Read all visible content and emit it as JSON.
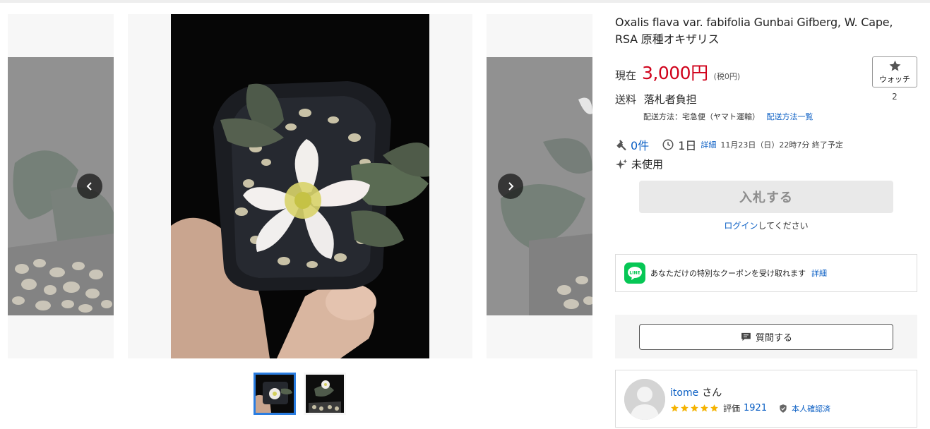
{
  "item": {
    "title": "Oxalis flava var. fabifolia Gunbai Gifberg, W. Cape, RSA 原種オキザリス",
    "price_label": "現在",
    "price_value": "3,000円",
    "price_tax": "(税0円)"
  },
  "watch": {
    "label": "ウォッチ",
    "count": "2",
    "icon": "star-icon"
  },
  "shipping": {
    "label": "送料",
    "value": "落札者負担",
    "method_text": "配送方法：宅急便（ヤマト運輸）",
    "method_link": "配送方法一覧"
  },
  "auction": {
    "bids": "0件",
    "time_left": "1日",
    "detail_link": "詳細",
    "end_text": "11月23日（日）22時7分 終了予定",
    "condition": "未使用"
  },
  "bid_button": {
    "label": "入札する"
  },
  "login": {
    "link": "ログイン",
    "suffix": "してください"
  },
  "line_banner": {
    "text": "あなただけの特別なクーポンを受け取れます",
    "detail": "詳細"
  },
  "question_button": {
    "label": "質問する"
  },
  "seller": {
    "name": "itome",
    "suffix": "さん",
    "rating_label": "評価",
    "rating_count": "1921",
    "verified": "本人確認済",
    "stars": 5
  },
  "gallery": {
    "thumbnail_count": 2,
    "active_index": 0
  },
  "colors": {
    "price": "#d0021b",
    "link": "#0b5fc4",
    "line": "#06c755",
    "star": "#f5b301",
    "active_thumb": "#2a7de1"
  }
}
